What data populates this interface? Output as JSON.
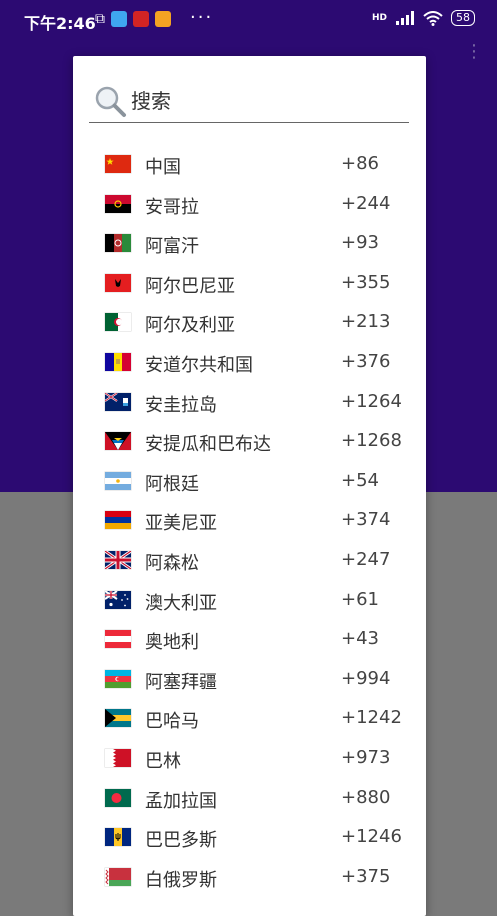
{
  "statusbar": {
    "time": "下午2:46",
    "network": "HD",
    "battery": "58"
  },
  "search": {
    "placeholder": "搜索"
  },
  "countries": [
    {
      "name": "中国",
      "code": "+86",
      "flag": "cn"
    },
    {
      "name": "安哥拉",
      "code": "+244",
      "flag": "ao"
    },
    {
      "name": "阿富汗",
      "code": "+93",
      "flag": "af"
    },
    {
      "name": "阿尔巴尼亚",
      "code": "+355",
      "flag": "al"
    },
    {
      "name": "阿尔及利亚",
      "code": "+213",
      "flag": "dz"
    },
    {
      "name": "安道尔共和国",
      "code": "+376",
      "flag": "ad"
    },
    {
      "name": "安圭拉岛",
      "code": "+1264",
      "flag": "ai"
    },
    {
      "name": "安提瓜和巴布达",
      "code": "+1268",
      "flag": "ag"
    },
    {
      "name": "阿根廷",
      "code": "+54",
      "flag": "ar"
    },
    {
      "name": "亚美尼亚",
      "code": "+374",
      "flag": "am"
    },
    {
      "name": "阿森松",
      "code": "+247",
      "flag": "ac"
    },
    {
      "name": "澳大利亚",
      "code": "+61",
      "flag": "au"
    },
    {
      "name": "奥地利",
      "code": "+43",
      "flag": "at"
    },
    {
      "name": "阿塞拜疆",
      "code": "+994",
      "flag": "az"
    },
    {
      "name": "巴哈马",
      "code": "+1242",
      "flag": "bs"
    },
    {
      "name": "巴林",
      "code": "+973",
      "flag": "bh"
    },
    {
      "name": "孟加拉国",
      "code": "+880",
      "flag": "bd"
    },
    {
      "name": "巴巴多斯",
      "code": "+1246",
      "flag": "bb"
    },
    {
      "name": "白俄罗斯",
      "code": "+375",
      "flag": "by"
    }
  ]
}
